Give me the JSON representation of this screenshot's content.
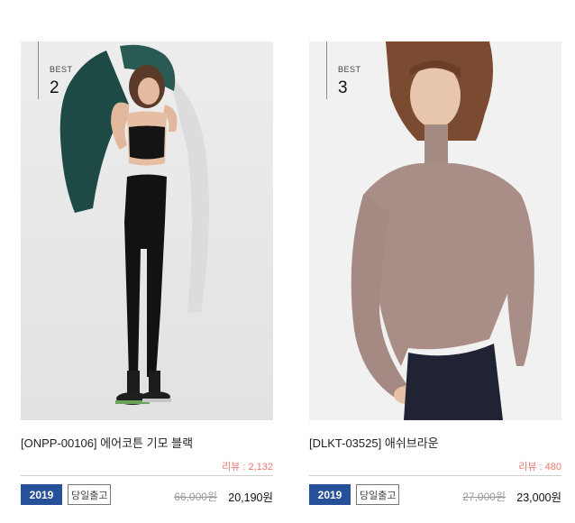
{
  "products": [
    {
      "rank_label": "BEST",
      "rank": "2",
      "title": "[ONPP-00106] 에어코튼 기모 블랙",
      "review": "리뷰 : 2,132",
      "year_badge": "2019",
      "ship_badge": "당일출고",
      "original_price": "66,000원",
      "sale_price": "20,190원",
      "image_icon": "model-photo-black-leggings"
    },
    {
      "rank_label": "BEST",
      "rank": "3",
      "title": "[DLKT-03525] 애쉬브라운",
      "review": "리뷰 : 480",
      "year_badge": "2019",
      "ship_badge": "당일출고",
      "original_price": "27,000원",
      "sale_price": "23,000원",
      "image_icon": "model-photo-brown-turtleneck"
    }
  ],
  "colors": {
    "year_badge_bg": "#26519a",
    "review_text": "#e97a6e",
    "divider": "#cfcfcf"
  }
}
